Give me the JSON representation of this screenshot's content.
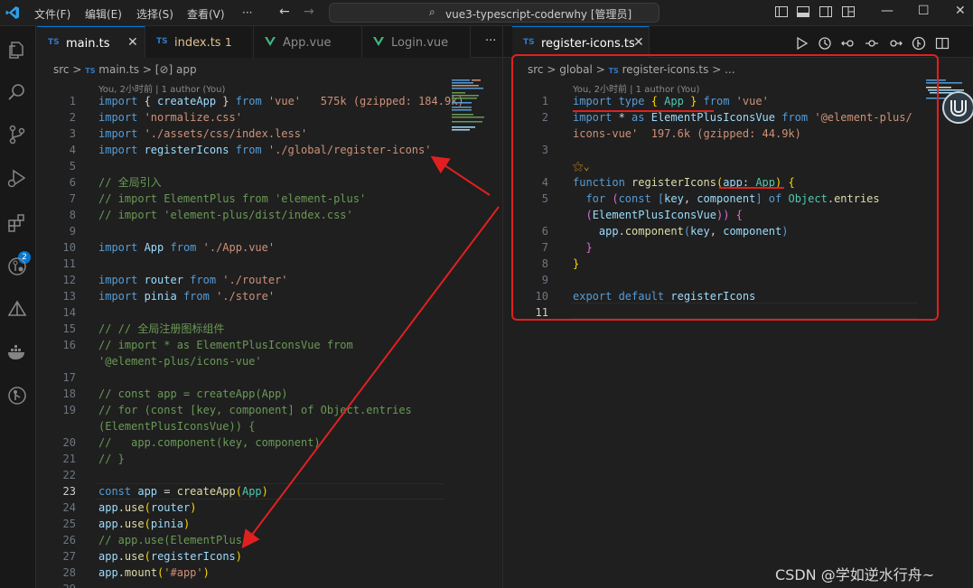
{
  "titlebar": {
    "menus": [
      "文件(F)",
      "编辑(E)",
      "选择(S)",
      "查看(V)",
      "···"
    ],
    "search_text": "vue3-typescript-coderwhy [管理员]",
    "window_controls": [
      "minimize-icon",
      "maximize-icon",
      "close-icon"
    ]
  },
  "activity_bar": {
    "icons": [
      "explorer-icon",
      "search-icon",
      "source-control-icon",
      "run-debug-icon",
      "extensions-icon",
      "gitlens-icon",
      "remote-icon",
      "docker-icon",
      "git-graph-icon"
    ],
    "extensions_badge": "2"
  },
  "left_editor": {
    "tabs": [
      {
        "label": "main.ts",
        "type": "TS",
        "active": true
      },
      {
        "label": "index.ts",
        "type": "TS",
        "modified": "1",
        "color": "#e2c08d"
      },
      {
        "label": "App.vue",
        "type": "vue"
      },
      {
        "label": "Login.vue",
        "type": "vue"
      }
    ],
    "more": "···",
    "breadcrumb": {
      "folder": "src",
      "sep": ">",
      "file": "main.ts",
      "symbol": "[⊘] app"
    },
    "blame": "You, 2小时前 | 1 author (You)",
    "lines": [
      {
        "n": "1",
        "tokens": [
          [
            "k",
            "import"
          ],
          [
            "w",
            " { "
          ],
          [
            "v",
            "createApp"
          ],
          [
            "w",
            " } "
          ],
          [
            "k",
            "from"
          ],
          [
            "s",
            " 'vue'"
          ],
          [
            "s",
            "   575k (gzipped: 184.9k)"
          ]
        ]
      },
      {
        "n": "2",
        "tokens": [
          [
            "k",
            "import"
          ],
          [
            "s",
            " 'normalize.css'"
          ]
        ]
      },
      {
        "n": "3",
        "tokens": [
          [
            "k",
            "import"
          ],
          [
            "s",
            " './assets/css/index.less'"
          ]
        ]
      },
      {
        "n": "4",
        "tokens": [
          [
            "k",
            "import"
          ],
          [
            "v",
            " registerIcons"
          ],
          [
            "k",
            " from"
          ],
          [
            "s",
            " './global/register-icons'"
          ]
        ]
      },
      {
        "n": "5",
        "tokens": []
      },
      {
        "n": "6",
        "tokens": [
          [
            "c",
            "// 全局引入"
          ]
        ]
      },
      {
        "n": "7",
        "tokens": [
          [
            "c",
            "// import ElementPlus from 'element-plus'"
          ]
        ]
      },
      {
        "n": "8",
        "tokens": [
          [
            "c",
            "// import 'element-plus/dist/index.css'"
          ]
        ]
      },
      {
        "n": "9",
        "tokens": []
      },
      {
        "n": "10",
        "tokens": [
          [
            "k",
            "import"
          ],
          [
            "v",
            " App"
          ],
          [
            "k",
            " from"
          ],
          [
            "s",
            " './App.vue'"
          ]
        ]
      },
      {
        "n": "11",
        "tokens": []
      },
      {
        "n": "12",
        "tokens": [
          [
            "k",
            "import"
          ],
          [
            "v",
            " router"
          ],
          [
            "k",
            " from"
          ],
          [
            "s",
            " './router'"
          ]
        ]
      },
      {
        "n": "13",
        "tokens": [
          [
            "k",
            "import"
          ],
          [
            "v",
            " pinia"
          ],
          [
            "k",
            " from"
          ],
          [
            "s",
            " './store'"
          ]
        ]
      },
      {
        "n": "14",
        "tokens": []
      },
      {
        "n": "15",
        "tokens": [
          [
            "c",
            "// // 全局注册图标组件"
          ]
        ]
      },
      {
        "n": "16",
        "tokens": [
          [
            "c",
            "// import * as ElementPlusIconsVue from"
          ]
        ]
      },
      {
        "n": "",
        "tokens": [
          [
            "c",
            "'@element-plus/icons-vue'"
          ]
        ]
      },
      {
        "n": "17",
        "tokens": []
      },
      {
        "n": "18",
        "tokens": [
          [
            "c",
            "// const app = createApp(App)"
          ]
        ]
      },
      {
        "n": "19",
        "tokens": [
          [
            "c",
            "// for (const [key, component] of Object.entries"
          ]
        ]
      },
      {
        "n": "",
        "tokens": [
          [
            "c",
            "(ElementPlusIconsVue)) {"
          ]
        ]
      },
      {
        "n": "20",
        "tokens": [
          [
            "c",
            "//   app.component(key, component)"
          ]
        ]
      },
      {
        "n": "21",
        "tokens": [
          [
            "c",
            "// }"
          ]
        ]
      },
      {
        "n": "22",
        "tokens": []
      },
      {
        "n": "23",
        "current": true,
        "tokens": [
          [
            "k",
            "const"
          ],
          [
            "v",
            " app"
          ],
          [
            "w",
            " = "
          ],
          [
            "f",
            "createApp"
          ],
          [
            "y",
            "("
          ],
          [
            "t",
            "App"
          ],
          [
            "y",
            ")"
          ]
        ]
      },
      {
        "n": "24",
        "tokens": [
          [
            "v",
            "app"
          ],
          [
            "w",
            "."
          ],
          [
            "f",
            "use"
          ],
          [
            "y",
            "("
          ],
          [
            "v",
            "router"
          ],
          [
            "y",
            ")"
          ]
        ]
      },
      {
        "n": "25",
        "tokens": [
          [
            "v",
            "app"
          ],
          [
            "w",
            "."
          ],
          [
            "f",
            "use"
          ],
          [
            "y",
            "("
          ],
          [
            "v",
            "pinia"
          ],
          [
            "y",
            ")"
          ]
        ]
      },
      {
        "n": "26",
        "tokens": [
          [
            "c",
            "// app.use(ElementPlus)"
          ]
        ]
      },
      {
        "n": "27",
        "tokens": [
          [
            "v",
            "app"
          ],
          [
            "w",
            "."
          ],
          [
            "f",
            "use"
          ],
          [
            "y",
            "("
          ],
          [
            "v",
            "registerIcons"
          ],
          [
            "y",
            ")"
          ]
        ]
      },
      {
        "n": "28",
        "tokens": [
          [
            "v",
            "app"
          ],
          [
            "w",
            "."
          ],
          [
            "f",
            "mount"
          ],
          [
            "y",
            "("
          ],
          [
            "s",
            "'#app'"
          ],
          [
            "y",
            ")"
          ]
        ]
      },
      {
        "n": "29",
        "tokens": []
      }
    ]
  },
  "right_editor": {
    "tab": {
      "label": "register-icons.ts",
      "type": "TS"
    },
    "actions": [
      "run-icon",
      "timeline-icon",
      "go-back-icon",
      "commit-icon",
      "go-forward-icon",
      "gitlens-icon",
      "split-editor-icon"
    ],
    "breadcrumb": {
      "src": "src",
      "folder": "global",
      "file": "register-icons.ts",
      "tail": "..."
    },
    "blame": "You, 2小时前 | 1 author (You)",
    "lines": [
      {
        "n": "1",
        "tokens": [
          [
            "k",
            "import"
          ],
          [
            "k",
            " type"
          ],
          [
            "y",
            " { "
          ],
          [
            "t",
            "App"
          ],
          [
            "y",
            " } "
          ],
          [
            "k",
            "from"
          ],
          [
            "s",
            " 'vue'"
          ]
        ]
      },
      {
        "n": "2",
        "tokens": [
          [
            "k",
            "import"
          ],
          [
            "w",
            " * "
          ],
          [
            "k",
            "as"
          ],
          [
            "v",
            " ElementPlusIconsVue"
          ],
          [
            "k",
            " from"
          ],
          [
            "s",
            " '@element-plus/"
          ]
        ]
      },
      {
        "n": "",
        "tokens": [
          [
            "s",
            "icons-vue'"
          ],
          [
            "s",
            "  197.6k (gzipped: 44.9k)"
          ]
        ]
      },
      {
        "n": "3",
        "tokens": []
      },
      {
        "n": "",
        "tokens": [
          [
            "lens",
            "⚝⌄"
          ]
        ]
      },
      {
        "n": "4",
        "tokens": [
          [
            "k",
            "function"
          ],
          [
            "f",
            " registerIcons"
          ],
          [
            "y",
            "("
          ],
          [
            "v",
            "app"
          ],
          [
            "w",
            ": "
          ],
          [
            "t",
            "App"
          ],
          [
            "y",
            ") {"
          ]
        ]
      },
      {
        "n": "5",
        "tokens": [
          [
            "k",
            "  for"
          ],
          [
            "p",
            " ("
          ],
          [
            "k",
            "const"
          ],
          [
            "k",
            " ["
          ],
          [
            "v",
            "key"
          ],
          [
            "w",
            ", "
          ],
          [
            "v",
            "component"
          ],
          [
            "k",
            "]"
          ],
          [
            "k",
            " of"
          ],
          [
            "t",
            " Object"
          ],
          [
            "w",
            "."
          ],
          [
            "f",
            "entries"
          ]
        ]
      },
      {
        "n": "",
        "tokens": [
          [
            "p",
            "  ("
          ],
          [
            "v",
            "ElementPlusIconsVue"
          ],
          [
            "p",
            "))"
          ],
          [
            "p",
            " {"
          ]
        ]
      },
      {
        "n": "6",
        "tokens": [
          [
            "v",
            "    app"
          ],
          [
            "w",
            "."
          ],
          [
            "f",
            "component"
          ],
          [
            "k",
            "("
          ],
          [
            "v",
            "key"
          ],
          [
            "w",
            ", "
          ],
          [
            "v",
            "component"
          ],
          [
            "k",
            ")"
          ]
        ]
      },
      {
        "n": "7",
        "tokens": [
          [
            "p",
            "  }"
          ]
        ]
      },
      {
        "n": "8",
        "tokens": [
          [
            "y",
            "}"
          ]
        ]
      },
      {
        "n": "9",
        "tokens": []
      },
      {
        "n": "10",
        "tokens": [
          [
            "k",
            "export"
          ],
          [
            "k",
            " default"
          ],
          [
            "v",
            " registerIcons"
          ]
        ]
      },
      {
        "n": "11",
        "current": true,
        "tokens": []
      }
    ]
  },
  "watermark": "CSDN @学如逆水行舟~",
  "colors": {
    "accent": "#0078d4",
    "annotation": "#e02020"
  }
}
